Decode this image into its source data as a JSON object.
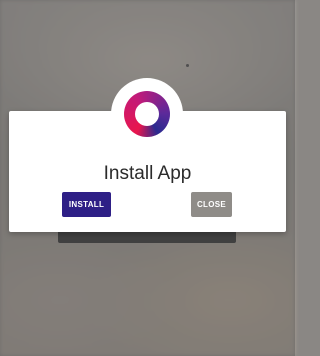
{
  "dialog": {
    "title": "Install App",
    "install_label": "INSTALL",
    "close_label": "CLOSE",
    "logo_icon": "app-logo-ring-icon"
  },
  "colors": {
    "install_button": "#2e1f86",
    "close_button": "#8f8c88",
    "logo_gradient_start": "#e8164d",
    "logo_gradient_end": "#2a2a8f"
  }
}
